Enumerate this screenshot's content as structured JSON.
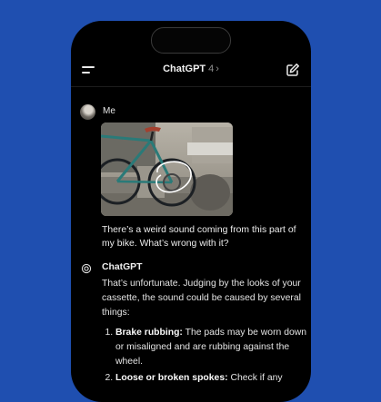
{
  "background_color": "#1f4fb0",
  "header": {
    "title": "ChatGPT",
    "version": "4",
    "chevron": "›",
    "menu_icon": "menu-icon",
    "new_chat_icon": "edit-icon"
  },
  "user_message": {
    "sender": "Me",
    "text": "There’s a weird sound coming from this part of my bike. What’s wrong with it?"
  },
  "assistant_message": {
    "sender": "ChatGPT",
    "intro": "That’s unfortunate. Judging by the looks of your cassette, the sound could be caused by several things:",
    "items": [
      {
        "title": "Brake rubbing:",
        "text": "The pads may be worn down or misaligned and are rubbing against the wheel."
      },
      {
        "title": "Loose or broken spokes:",
        "text": "Check if any"
      }
    ]
  }
}
